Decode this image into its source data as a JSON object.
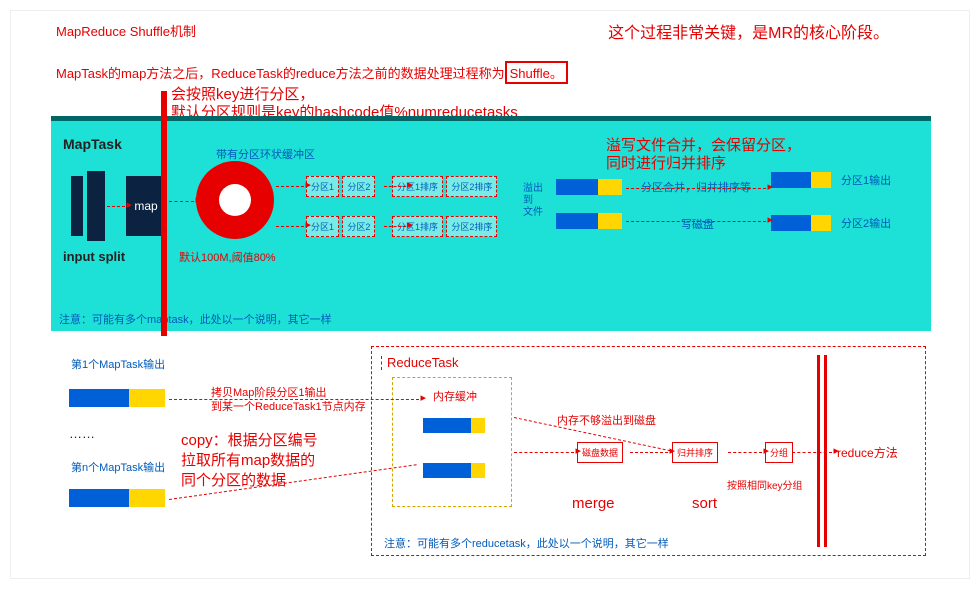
{
  "header": {
    "title": "MapReduce Shuffle机制",
    "desc_pre": "MapTask的map方法之后，ReduceTask的reduce方法之前的数据处理过程称为",
    "shuffle": "Shuffle。",
    "note_red": "这个过程非常关键，是MR的核心阶段。"
  },
  "anno_partition": {
    "l1": "会按照key进行分区，",
    "l2": "默认分区规则是key的hashcode值%numreducetasks"
  },
  "maptask": {
    "title": "MapTask",
    "input": "input split",
    "map": "map",
    "buffer_title": "带有分区环状缓冲区",
    "threshold": "默认100M,阈值80%",
    "p1": "分区1",
    "p2": "分区2",
    "s1": "分区1排序",
    "s2": "分区2排序",
    "spill_label": "溢出\n到\n文件",
    "merge_anno1": "溢写文件合并，会保留分区，",
    "merge_anno2": "同时进行归并排序",
    "merge_label": "分区合并，归并排序等",
    "disk": "写磁盘",
    "out1": "分区1输出",
    "out2": "分区2输出",
    "footnote": "注意：可能有多个maptask，此处以一个说明，其它一样"
  },
  "bottom": {
    "out_first": "第1个MapTask输出",
    "out_n": "第n个MapTask输出",
    "dots": "……",
    "copy_anno1": "拷贝Map阶段分区1输出",
    "copy_anno2": "到某一个ReduceTask1节点内存",
    "copy_big": "copy：根据分区编号\n拉取所有map数据的\n同个分区的数据"
  },
  "reduce": {
    "title": "ReduceTask",
    "membuf": "内存缓冲",
    "spill": "内存不够溢出到磁盘",
    "diskdata": "磁盘数据",
    "mergesort": "归并排序",
    "group": "分组",
    "by_key": "按照相同key分组",
    "reduce_m": "reduce方法",
    "merge_lbl": "merge",
    "sort_lbl": "sort",
    "footnote": "注意：可能有多个reducetask，此处以一个说明，其它一样"
  }
}
